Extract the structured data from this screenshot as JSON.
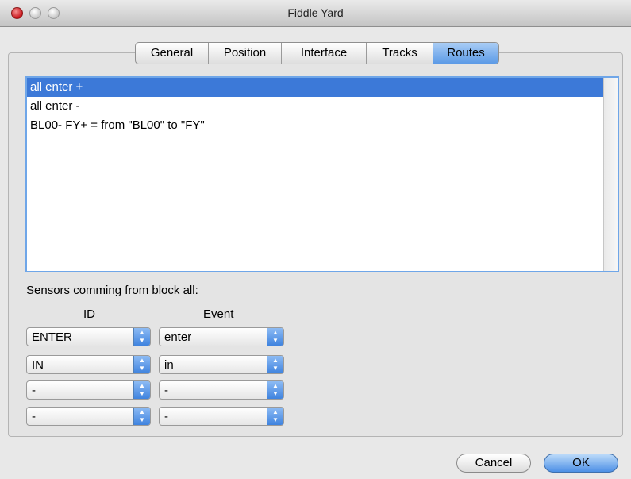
{
  "window": {
    "title": "Fiddle Yard"
  },
  "tabs": [
    {
      "label": "General",
      "active": false
    },
    {
      "label": "Position",
      "active": false
    },
    {
      "label": "Interface",
      "active": false
    },
    {
      "label": "Tracks",
      "active": false
    },
    {
      "label": "Routes",
      "active": true
    }
  ],
  "routes": {
    "items": [
      {
        "label": "all enter +",
        "selected": true
      },
      {
        "label": "all enter -",
        "selected": false
      },
      {
        "label": "BL00- FY+ = from \"BL00\" to \"FY\"",
        "selected": false
      }
    ]
  },
  "sensors": {
    "label": "Sensors comming from block all:",
    "id_header": "ID",
    "event_header": "Event",
    "rows": [
      {
        "id": "ENTER",
        "event": "enter"
      },
      {
        "id": "IN",
        "event": "in"
      },
      {
        "id": "-",
        "event": "-"
      },
      {
        "id": "-",
        "event": "-"
      }
    ]
  },
  "buttons": {
    "cancel": "Cancel",
    "ok": "OK"
  },
  "colors": {
    "selection": "#3c79d8",
    "accent": "#5c9ae6"
  }
}
